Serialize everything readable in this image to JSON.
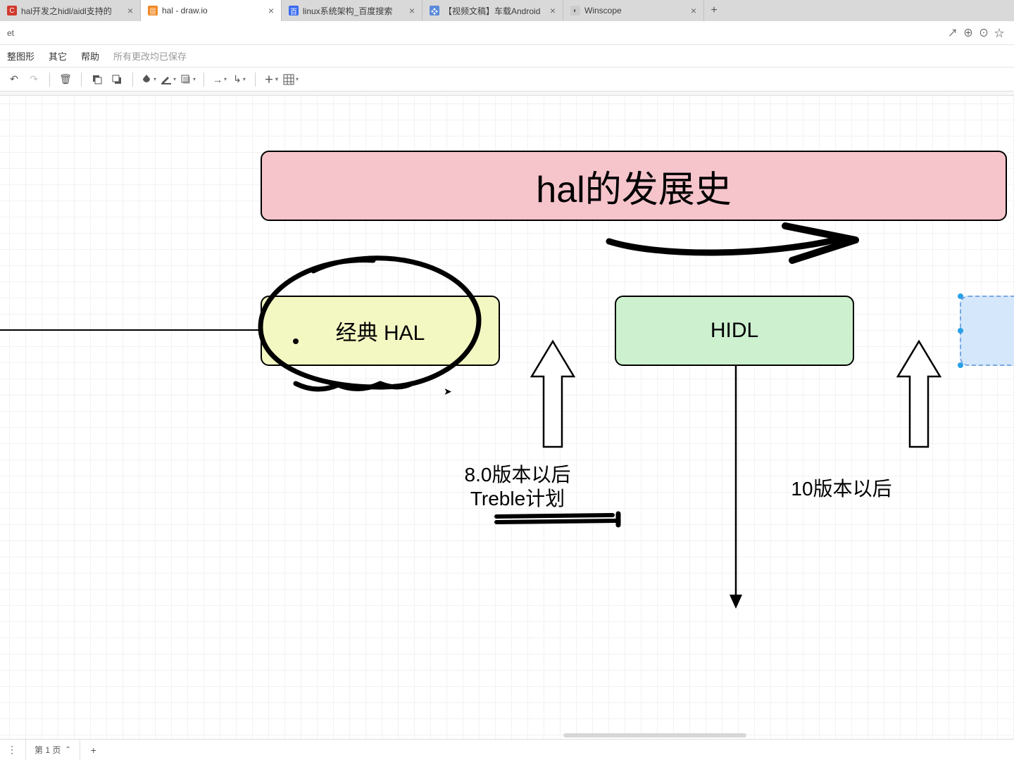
{
  "tabs": [
    {
      "title": "hal开发之hidl/aidl支持的",
      "fav_bg": "#d03a2f",
      "fav_txt": "C"
    },
    {
      "title": "hal - draw.io",
      "fav_bg": "#f08a24",
      "fav_txt": "▦"
    },
    {
      "title": "linux系统架构_百度搜索",
      "fav_bg": "#3a6cf0",
      "fav_txt": "百"
    },
    {
      "title": "【视频文稿】车载Android",
      "fav_bg": "#5a8bd8",
      "fav_txt": "❖"
    },
    {
      "title": "Winscope",
      "fav_bg": "#cccccc",
      "fav_txt": "◐"
    }
  ],
  "active_tab_index": 1,
  "url_hint": "et",
  "menu": {
    "items": [
      "整图形",
      "其它",
      "帮助"
    ],
    "save_status": "所有更改均已保存"
  },
  "footer": {
    "page_label": "第 1 页"
  },
  "diagram": {
    "title": "hal的发展史",
    "box_hal": "经典 HAL",
    "box_hidl": "HIDL",
    "label_v8_line1": "8.0版本以后",
    "label_v8_line2": "Treble计划",
    "label_v10": "10版本以后"
  },
  "chart_data": {
    "type": "diagram",
    "title": "hal的发展史",
    "nodes": [
      {
        "id": "classic_hal",
        "label": "经典 HAL",
        "color": "#f3f7c2",
        "highlight": "circled"
      },
      {
        "id": "hidl",
        "label": "HIDL",
        "color": "#cdf0cf"
      },
      {
        "id": "next",
        "label": "",
        "color": "#d4e7fb",
        "state": "selected"
      }
    ],
    "annotations": [
      {
        "target_between": [
          "classic_hal",
          "hidl"
        ],
        "text": "8.0版本以后 Treble计划",
        "underline": true
      },
      {
        "target_between": [
          "hidl",
          "next"
        ],
        "text": "10版本以后"
      }
    ],
    "edges": [
      {
        "from": "left-edge",
        "to": "classic_hal",
        "style": "line"
      },
      {
        "from": "hidl",
        "to": "bottom",
        "style": "arrow-down"
      },
      {
        "from": "title",
        "to": "right",
        "style": "freehand-arrow-right"
      }
    ]
  }
}
